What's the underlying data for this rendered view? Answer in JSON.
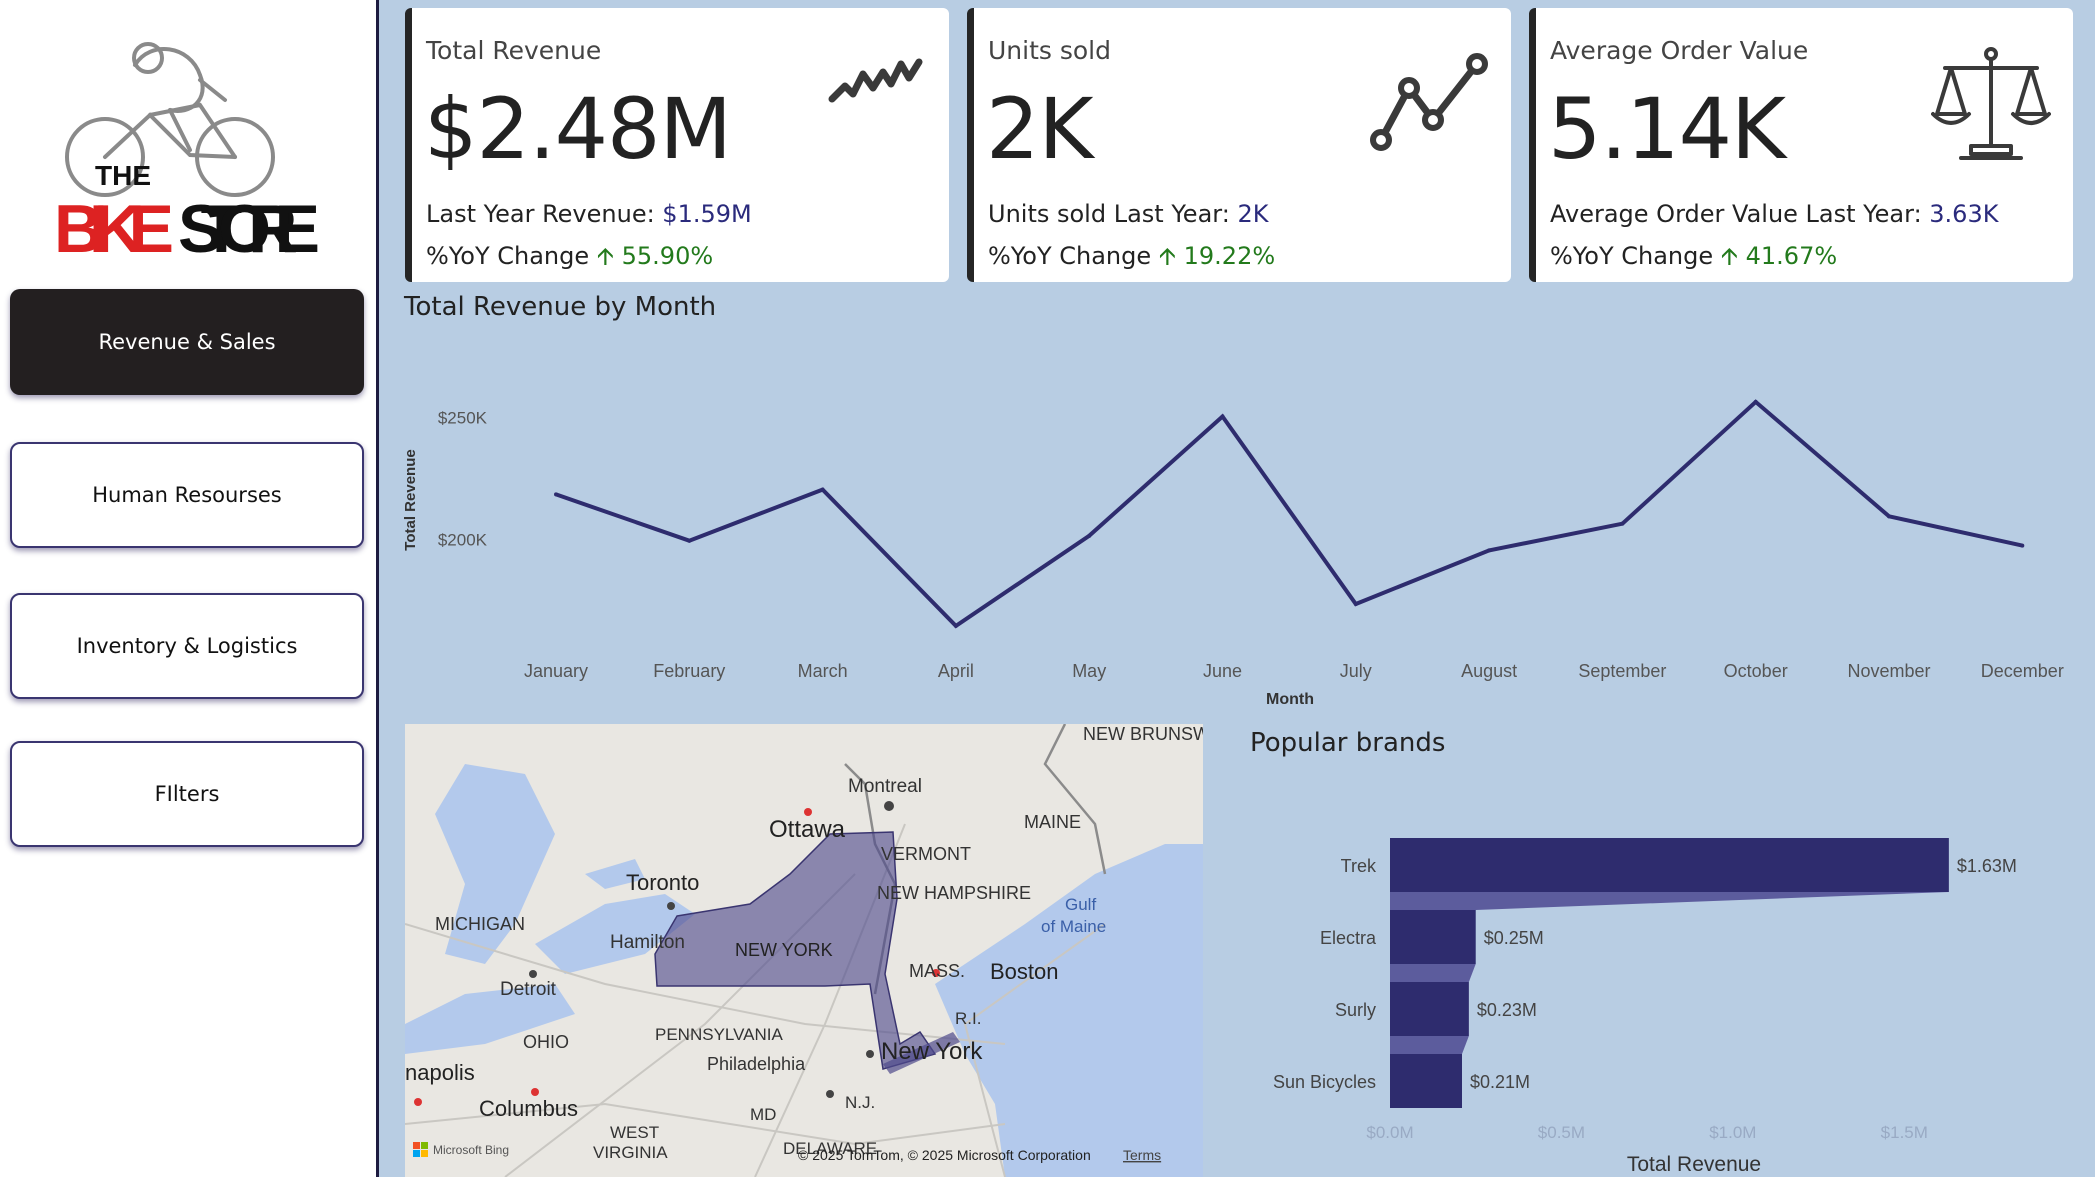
{
  "sidebar": {
    "logo": {
      "the": "THE",
      "bike": "BIKE",
      "store": "STORE"
    },
    "nav": [
      {
        "label": "Revenue & Sales",
        "active": true
      },
      {
        "label": "Human Resourses",
        "active": false
      },
      {
        "label": "Inventory & Logistics",
        "active": false
      },
      {
        "label": "FIlters",
        "active": false
      }
    ]
  },
  "kpis": [
    {
      "title": "Total Revenue",
      "value": "$2.48M",
      "ly_label": "Last Year Revenue: ",
      "ly_value": "$1.59M",
      "yoy_label": "%YoY Change ",
      "yoy_value": "55.90%",
      "icon": "trend-squiggle-icon"
    },
    {
      "title": "Units sold",
      "value": "2K",
      "ly_label": "Units sold Last Year: ",
      "ly_value": "2K",
      "yoy_label": "%YoY Change ",
      "yoy_value": "19.22%",
      "icon": "line-graph-icon"
    },
    {
      "title": "Average Order Value",
      "value": "5.14K",
      "ly_label": "Average Order Value Last Year: ",
      "ly_value": "3.63K",
      "yoy_label": "%YoY Change ",
      "yoy_value": "41.67%",
      "icon": "balance-scale-icon"
    }
  ],
  "colors": {
    "accent": "#2e2c6e",
    "up": "#237a1c",
    "panel": "#b8cde3"
  },
  "line_panel": {
    "title": "Total Revenue by Month"
  },
  "brands_panel": {
    "title": "Popular brands"
  },
  "map": {
    "labels": [
      "NEW BRUNSW",
      "Montreal",
      "Ottawa",
      "VERMONT",
      "MAINE",
      "NEW HAMPSHIRE",
      "Gulf",
      "of Maine",
      "Toronto",
      "MICHIGAN",
      "Hamilton",
      "NEW YORK",
      "MASS.",
      "Boston",
      "Detroit",
      "R.I.",
      "OHIO",
      "PENNSYLVANIA",
      "New York",
      "Philadelphia",
      "napolis",
      "Columbus",
      "N.J.",
      "MD",
      "WEST",
      "VIRGINIA",
      "DELAWARE"
    ],
    "attribution": "© 2025 TomTom, © 2025 Microsoft Corporation",
    "terms": "Terms",
    "bing": "Microsoft Bing"
  },
  "chart_data": [
    {
      "type": "line",
      "title": "Total Revenue by Month",
      "xlabel": "Month",
      "ylabel": "Total Revenue",
      "categories": [
        "January",
        "February",
        "March",
        "April",
        "May",
        "June",
        "July",
        "August",
        "September",
        "October",
        "November",
        "December"
      ],
      "values": [
        218000,
        199000,
        220000,
        164000,
        201000,
        250000,
        173000,
        195000,
        206000,
        256000,
        209000,
        197000
      ],
      "ylim": [
        150000,
        265000
      ],
      "yticks": [
        200000,
        250000
      ],
      "ytick_labels": [
        "$200K",
        "$250K"
      ],
      "grid": false,
      "color": "#2e2c6e"
    },
    {
      "type": "bar",
      "orientation": "horizontal",
      "title": "Popular brands",
      "xlabel": "Total Revenue",
      "categories": [
        "Trek",
        "Electra",
        "Surly",
        "Sun Bicycles"
      ],
      "values": [
        1.63,
        0.25,
        0.23,
        0.21
      ],
      "data_labels": [
        "$1.63M",
        "$0.25M",
        "$0.23M",
        "$0.21M"
      ],
      "xlim": [
        0,
        1.75
      ],
      "xticks": [
        0,
        0.5,
        1.0,
        1.5
      ],
      "xtick_labels": [
        "$0.0M",
        "$0.5M",
        "$1.0M",
        "$1.5M"
      ],
      "color": "#2e2c6e"
    }
  ]
}
